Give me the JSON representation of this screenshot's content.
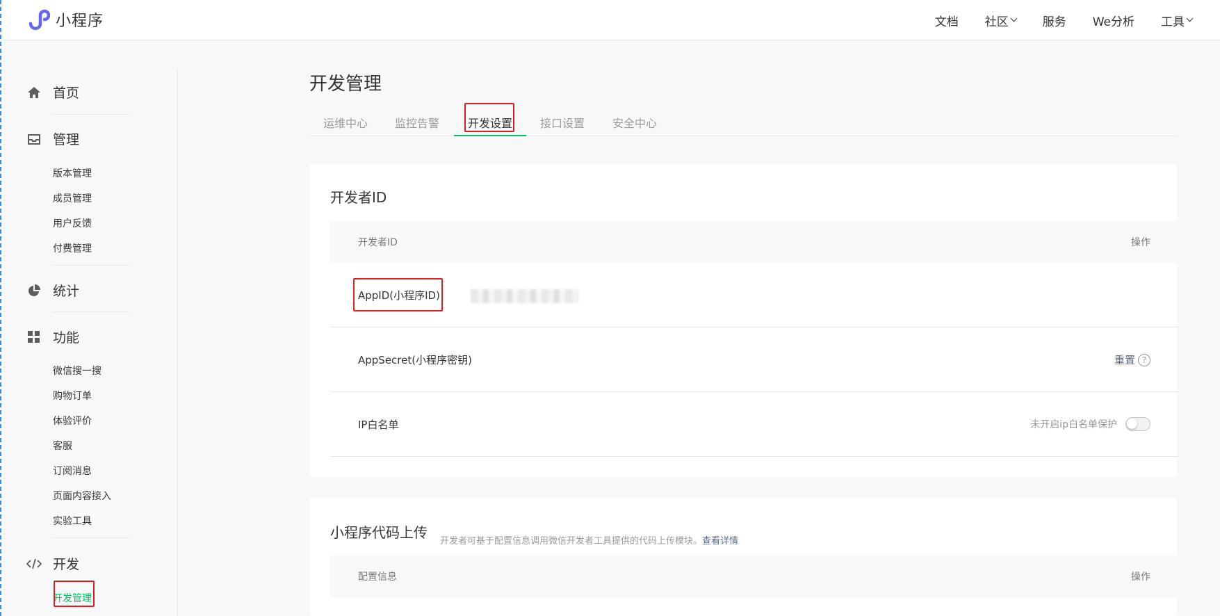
{
  "colors": {
    "accent_green": "#07c160",
    "link_blue": "#576b95",
    "highlight_red": "#e02020"
  },
  "header": {
    "logo_text": "小程序",
    "nav": [
      {
        "label": "文档",
        "dropdown": false
      },
      {
        "label": "社区",
        "dropdown": true
      },
      {
        "label": "服务",
        "dropdown": false
      },
      {
        "label": "We分析",
        "dropdown": false
      },
      {
        "label": "工具",
        "dropdown": true
      }
    ]
  },
  "sidebar": {
    "home": {
      "label": "首页",
      "icon": "home-icon"
    },
    "manage": {
      "label": "管理",
      "icon": "inbox-icon",
      "items": [
        "版本管理",
        "成员管理",
        "用户反馈",
        "付费管理"
      ]
    },
    "stats": {
      "label": "统计",
      "icon": "pie-chart-icon"
    },
    "features": {
      "label": "功能",
      "icon": "grid-icon",
      "items": [
        "微信搜一搜",
        "购物订单",
        "体验评价",
        "客服",
        "订阅消息",
        "页面内容接入",
        "实验工具"
      ]
    },
    "dev": {
      "label": "开发",
      "icon": "code-icon",
      "items": [
        "开发管理"
      ],
      "active_item": "开发管理"
    }
  },
  "main": {
    "title": "开发管理",
    "tabs": [
      "运维中心",
      "监控告警",
      "开发设置",
      "接口设置",
      "安全中心"
    ],
    "active_tab": "开发设置",
    "developer_id": {
      "title": "开发者ID",
      "header_left": "开发者ID",
      "header_right": "操作",
      "rows": {
        "appid_label": "AppID(小程序ID)",
        "appsecret_label": "AppSecret(小程序密钥)",
        "appsecret_action": "重置",
        "help_glyph": "?",
        "ip_label": "IP白名单",
        "ip_status": "未开启ip白名单保护",
        "ip_toggle_on": false
      }
    },
    "upload": {
      "title": "小程序代码上传",
      "desc": "开发者可基于配置信息调用微信开发者工具提供的代码上传模块。",
      "desc_link": "查看详情",
      "header_left": "配置信息",
      "header_right": "操作"
    }
  }
}
